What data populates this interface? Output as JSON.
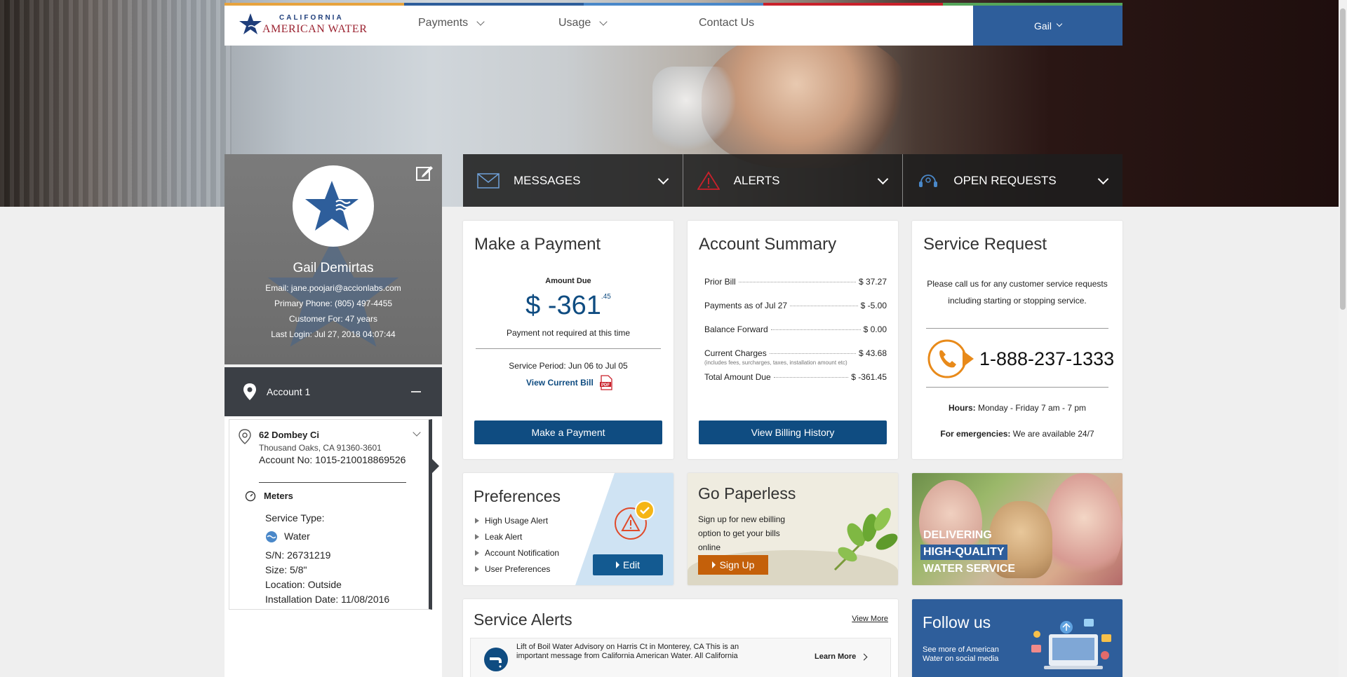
{
  "header": {
    "logo_line1": "CALIFORNIA",
    "logo_line2": "AMERICAN WATER",
    "nav": [
      "Payments",
      "Usage",
      "Contact Us"
    ],
    "user_name": "Gail",
    "stripe_colors": [
      "#e7a33e",
      "#2e5e9b",
      "#4a88c9",
      "#c9212b",
      "#55a55a"
    ]
  },
  "tabs": [
    {
      "label": "MESSAGES",
      "icon": "envelope-icon"
    },
    {
      "label": "ALERTS",
      "icon": "warning-icon"
    },
    {
      "label": "OPEN REQUESTS",
      "icon": "support-icon"
    }
  ],
  "profile": {
    "name": "Gail Demirtas",
    "email": "Email: jane.poojari@accionlabs.com",
    "phone": "Primary Phone: (805) 497-4455",
    "customer_for": "Customer For: 47 years",
    "last_login": "Last Login: Jul 27, 2018 04:07:44"
  },
  "account": {
    "label": "Account 1",
    "address_line1": "62 Dombey Ci",
    "address_line2": "Thousand Oaks, CA 91360-3601",
    "account_no": "Account No: 1015-210018869526",
    "meters_title": "Meters",
    "service_type_label": "Service Type:",
    "service_type": "Water",
    "serial": "S/N: 26731219",
    "size": "Size: 5/8\"",
    "location": "Location: Outside",
    "install_date": "Installation Date: 11/08/2016"
  },
  "payment": {
    "title": "Make a Payment",
    "amount_due_label": "Amount Due",
    "amount_main": "$ -361",
    "amount_cents": ".45",
    "note": "Payment not required at this time",
    "service_period": "Service Period: Jun 06 to Jul 05",
    "view_bill": "View Current Bill",
    "button": "Make a Payment"
  },
  "summary": {
    "title": "Account Summary",
    "rows": [
      {
        "label": "Prior Bill",
        "value": "$ 37.27"
      },
      {
        "label": "Payments as of Jul 27",
        "value": "$ -5.00"
      },
      {
        "label": "Balance Forward",
        "value": "$ 0.00"
      },
      {
        "label": "Current Charges",
        "value": "$ 43.68"
      },
      {
        "label": "Total Amount Due",
        "value": "$ -361.45"
      }
    ],
    "note": "(includes fees, surcharges, taxes, installation amount etc)",
    "button": "View Billing History"
  },
  "service": {
    "title": "Service Request",
    "text": "Please call us for any customer service requests including starting or stopping service.",
    "phone": "1-888-237-1333",
    "hours_label": "Hours:",
    "hours": "Monday - Friday 7 am - 7 pm",
    "emerg_label": "For emergencies:",
    "emerg": "We are available 24/7"
  },
  "preferences": {
    "title": "Preferences",
    "items": [
      "High Usage Alert",
      "Leak Alert",
      "Account Notification",
      "User Preferences"
    ],
    "button": "Edit"
  },
  "paperless": {
    "title": "Go Paperless",
    "text": "Sign up for new ebilling option to get your bills online",
    "button": "Sign Up"
  },
  "promo": {
    "line1": "DELIVERING",
    "line2": "HIGH-QUALITY",
    "line3": "WATER SERVICE"
  },
  "service_alerts": {
    "title": "Service Alerts",
    "view_more": "View More",
    "alert_text": "Lift of Boil Water Advisory on Harris Ct in Monterey, CA This is an important message from California American Water. All California",
    "learn_more": "Learn More"
  },
  "follow": {
    "title": "Follow us",
    "text": "See more of American Water on social media"
  },
  "colors": {
    "brand_blue": "#0f4c81",
    "accent_orange": "#c4600a",
    "header_user": "#2e5e9b"
  }
}
